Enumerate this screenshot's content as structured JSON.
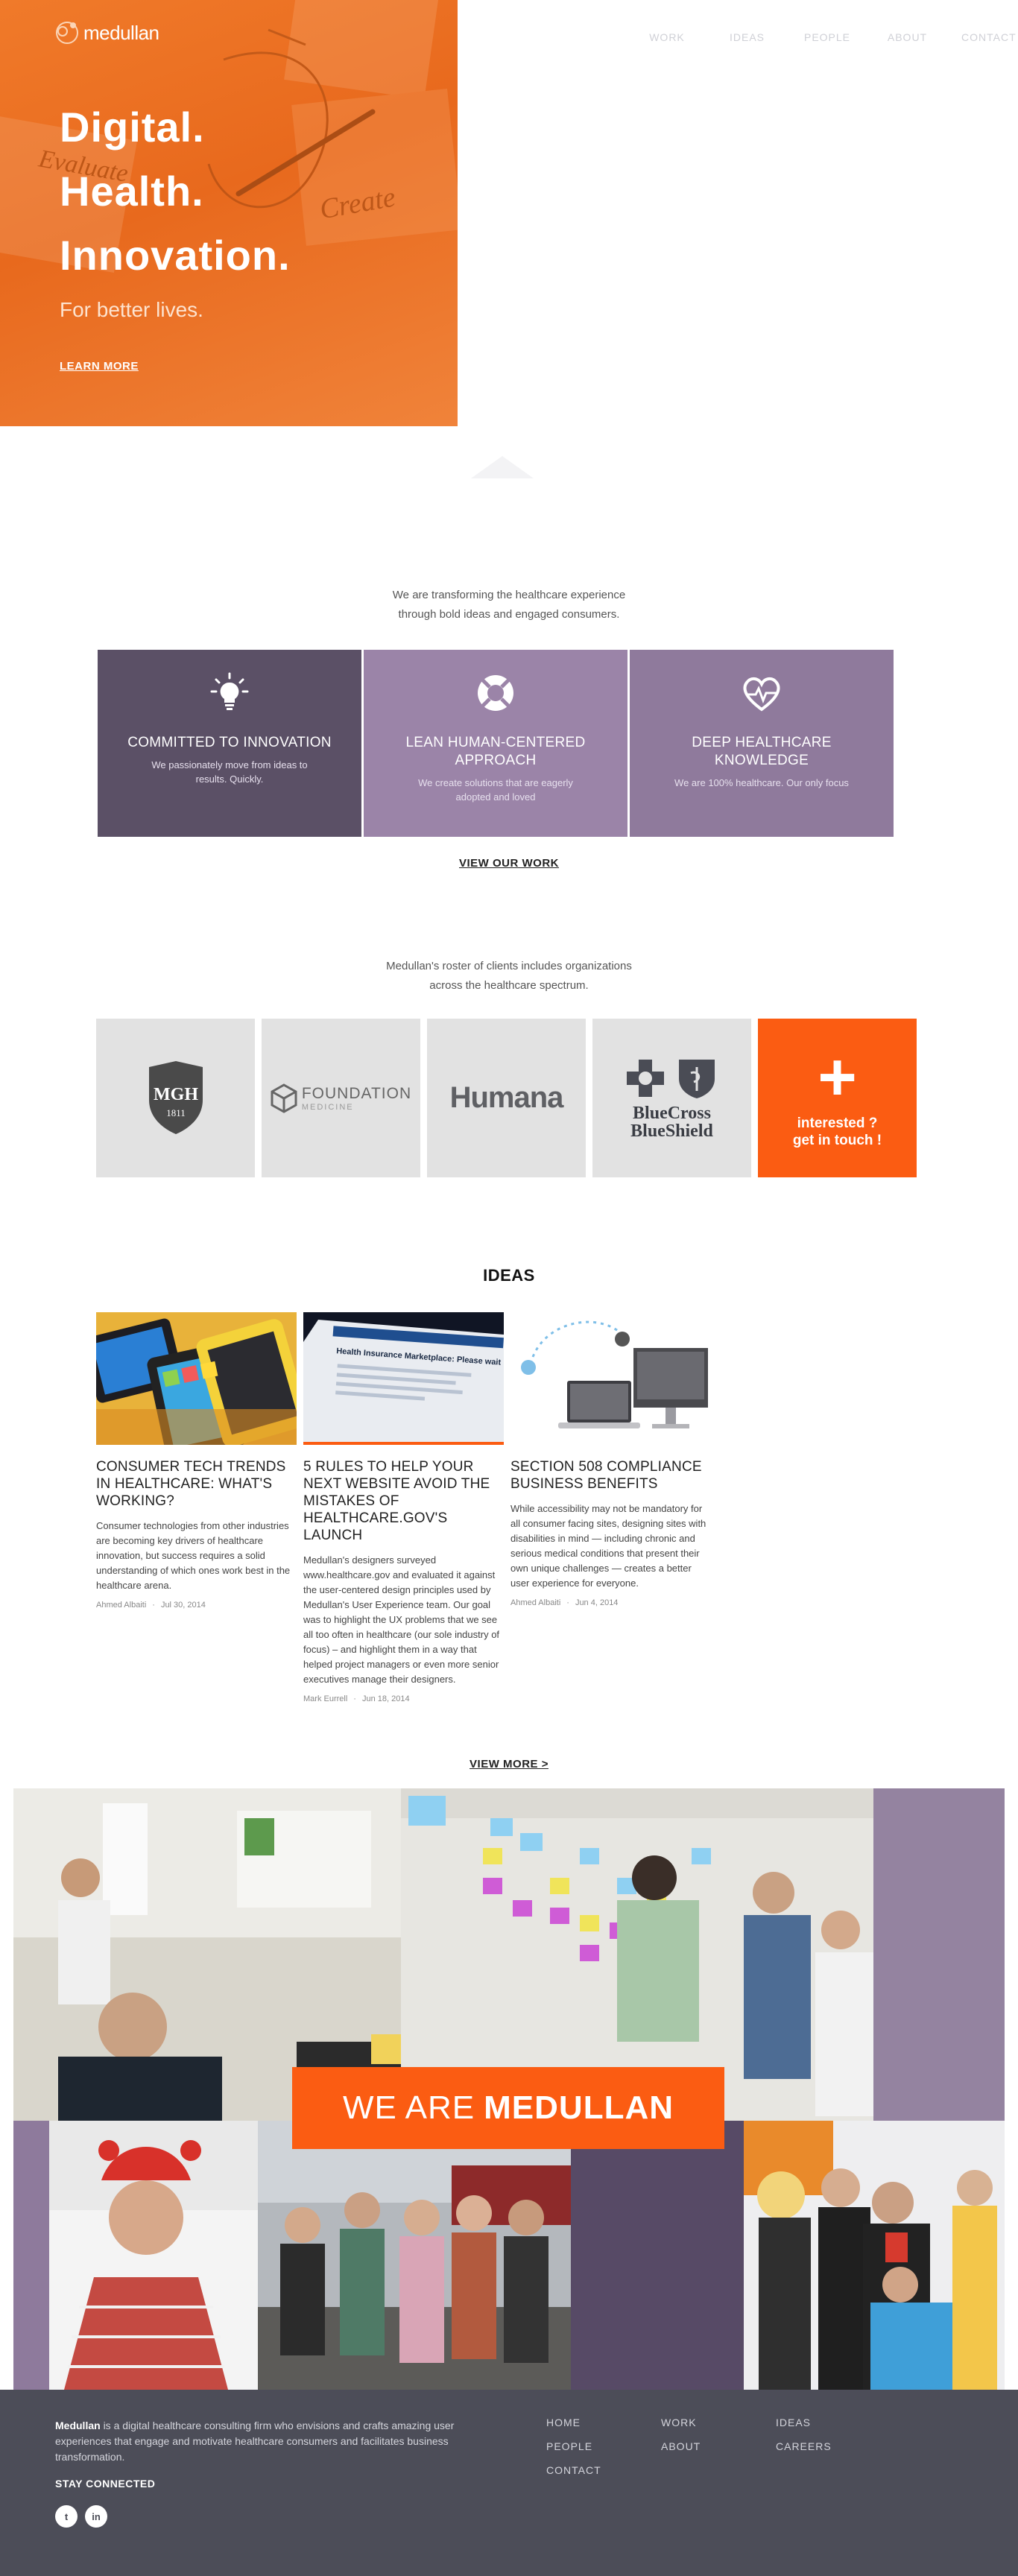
{
  "brand": {
    "name": "medullan",
    "accent": "#fb5c12",
    "purple_dark": "#5b5066",
    "purple_light": "#9b84a8",
    "footer_bg": "#4c4d58"
  },
  "nav": {
    "items": [
      "WORK",
      "IDEAS",
      "PEOPLE",
      "ABOUT",
      "CONTACT"
    ]
  },
  "hero": {
    "line1": "Digital.",
    "line2": "Health.",
    "line3": "Innovation.",
    "subtitle": "For better lives.",
    "cta": "LEARN MORE",
    "sketch_words": [
      "Evaluate",
      "Create"
    ]
  },
  "intro": {
    "line1": "We are transforming the healthcare experience",
    "line2": "through bold ideas and engaged consumers."
  },
  "pillars": [
    {
      "title": "COMMITTED TO INNOVATION",
      "text": "We passionately move from ideas to results. Quickly.",
      "icon": "lightbulb-icon"
    },
    {
      "title": "LEAN HUMAN-CENTERED APPROACH",
      "text": "We create solutions that are eagerly adopted and loved",
      "icon": "lifebuoy-icon"
    },
    {
      "title": "DEEP HEALTHCARE KNOWLEDGE",
      "text": "We are 100% healthcare. Our only focus",
      "icon": "heart-pulse-icon"
    }
  ],
  "view_work": "VIEW OUR WORK",
  "clients_intro": {
    "line1": "Medullan's roster of clients includes organizations",
    "line2": "across the healthcare spectrum."
  },
  "clients": {
    "mgh": {
      "abbr": "MGH",
      "year": "1811"
    },
    "foundation": {
      "name": "FOUNDATION",
      "sub": "MEDICINE"
    },
    "humana": {
      "name": "Humana"
    },
    "bcbs": {
      "line1": "BlueCross",
      "line2": "BlueShield"
    },
    "cta": {
      "plus": "+",
      "line1": "interested ?",
      "line2": "get in touch !"
    }
  },
  "ideas": {
    "title": "IDEAS",
    "posts": [
      {
        "title": "CONSUMER TECH TRENDS IN HEALTHCARE: WHAT'S WORKING?",
        "excerpt": "Consumer technologies from other industries are becoming key drivers of healthcare innovation, but success requires a solid understanding of which ones work best in the healthcare arena.",
        "author": "Ahmed Albaiti",
        "date": "Jul 30, 2014"
      },
      {
        "title": "5 RULES TO HELP YOUR NEXT WEBSITE AVOID THE MISTAKES OF HEALTHCARE.GOV'S LAUNCH",
        "excerpt": "Medullan's designers surveyed www.healthcare.gov and evaluated it against the user-centered design principles used by Medullan's User Experience team. Our goal was to highlight the UX problems that we see all too often in healthcare (our sole industry of focus) – and highlight them in a way that helped project managers or even more senior executives manage their designers.",
        "author": "Mark Eurrell",
        "date": "Jun 18, 2014",
        "thumb_caption": "Health Insurance Marketplace: Please wait"
      },
      {
        "title": "SECTION 508 COMPLIANCE BUSINESS BENEFITS",
        "excerpt": "While accessibility may not be mandatory for all consumer facing sites, designing sites with disabilities in mind — including chronic and serious medical conditions that present their own unique challenges — creates a better user experience for everyone.",
        "author": "Ahmed Albaiti",
        "date": "Jun 4, 2014"
      }
    ],
    "view_more": "VIEW MORE >"
  },
  "collage": {
    "banner_light": "WE ARE",
    "banner_bold": "MEDULLAN"
  },
  "footer": {
    "brand": "Medullan",
    "about": "is a digital healthcare consulting firm who envisions and crafts amazing user experiences that engage and motivate healthcare consumers and facilitates business transformation.",
    "stay": "STAY CONNECTED",
    "social": [
      "twitter-icon",
      "linkedin-icon"
    ],
    "social_glyphs": [
      "t",
      "in"
    ],
    "nav": [
      "HOME",
      "WORK",
      "IDEAS",
      "PEOPLE",
      "ABOUT",
      "CAREERS",
      "CONTACT"
    ]
  }
}
